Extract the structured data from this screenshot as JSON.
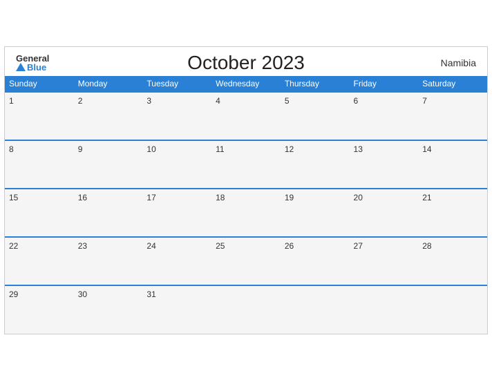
{
  "header": {
    "logo_general": "General",
    "logo_blue": "Blue",
    "title": "October 2023",
    "country": "Namibia"
  },
  "weekdays": [
    "Sunday",
    "Monday",
    "Tuesday",
    "Wednesday",
    "Thursday",
    "Friday",
    "Saturday"
  ],
  "weeks": [
    [
      "1",
      "2",
      "3",
      "4",
      "5",
      "6",
      "7"
    ],
    [
      "8",
      "9",
      "10",
      "11",
      "12",
      "13",
      "14"
    ],
    [
      "15",
      "16",
      "17",
      "18",
      "19",
      "20",
      "21"
    ],
    [
      "22",
      "23",
      "24",
      "25",
      "26",
      "27",
      "28"
    ],
    [
      "29",
      "30",
      "31",
      "",
      "",
      "",
      ""
    ]
  ]
}
